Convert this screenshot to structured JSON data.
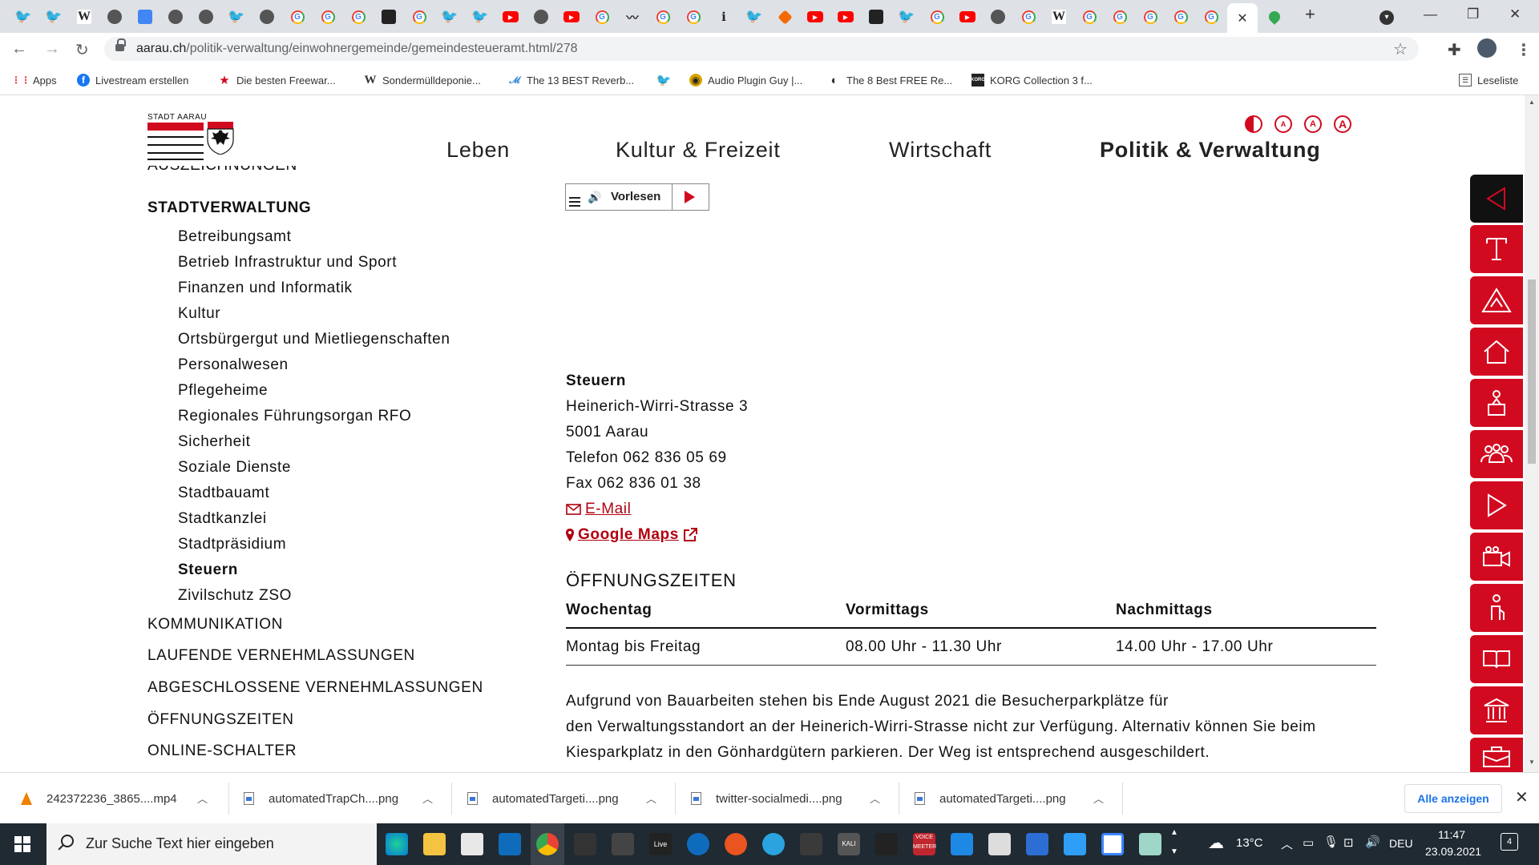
{
  "browser": {
    "url_host": "aarau.ch",
    "url_path": "/politik-verwaltung/einwohnergemeinde/gemeindesteueramt.html/278",
    "active_tab_close": "✕",
    "new_tab": "+"
  },
  "bookmarks": [
    {
      "label": "Apps",
      "icon": "apps-grid-icon"
    },
    {
      "label": "Livestream erstellen",
      "icon": "facebook-icon"
    },
    {
      "label": "Die besten Freewar...",
      "icon": "star-icon"
    },
    {
      "label": "Sondermülldeponie...",
      "icon": "wikipedia-icon"
    },
    {
      "label": "The 13 BEST Reverb...",
      "icon": "bird-icon"
    },
    {
      "label": "",
      "icon": "twitter-icon"
    },
    {
      "label": "Audio Plugin Guy |...",
      "icon": "plugin-icon"
    },
    {
      "label": "The 8 Best FREE Re...",
      "icon": "moon-icon"
    },
    {
      "label": "KORG Collection 3 f...",
      "icon": "korg-icon"
    }
  ],
  "reading_list": "Leseliste",
  "site": {
    "logo_text": "STADT AARAU",
    "nav": [
      "Leben",
      "Kultur & Freizeit",
      "Wirtschaft",
      "Politik & Verwaltung"
    ],
    "access_labels": [
      "A",
      "A",
      "A"
    ],
    "sidebar_top_cut": "AUSZEICHNUNGEN",
    "sidebar_section": "STADTVERWALTUNG",
    "sidebar_items": [
      "Betreibungsamt",
      "Betrieb Infrastruktur und Sport",
      "Finanzen und Informatik",
      "Kultur",
      "Ortsbürgergut und Mietliegenschaften",
      "Personalwesen",
      "Pflegeheime",
      "Regionales Führungsorgan RFO",
      "Sicherheit",
      "Soziale Dienste",
      "Stadtbauamt",
      "Stadtkanzlei",
      "Stadtpräsidium",
      "Steuern",
      "Zivilschutz ZSO"
    ],
    "sidebar_more": [
      "KOMMUNIKATION",
      "LAUFENDE VERNEHMLASSUNGEN",
      "ABGESCHLOSSENE VERNEHMLASSUNGEN",
      "ÖFFNUNGSZEITEN",
      "ONLINE-SCHALTER"
    ],
    "vorlesen": "Vorlesen",
    "contact": {
      "name": "Steuern",
      "street": "Heinerich-Wirri-Strasse 3",
      "city": "5001 Aarau",
      "phone": "Telefon 062 836 05 69",
      "fax": "Fax 062 836 01 38",
      "email": "E-Mail",
      "maps": "Google Maps"
    },
    "hours": {
      "title": "ÖFFNUNGSZEITEN",
      "headers": [
        "Wochentag",
        "Vormittags",
        "Nachmittags"
      ],
      "rows": [
        [
          "Montag bis Freitag",
          "08.00 Uhr - 11.30 Uhr",
          "14.00 Uhr - 17.00 Uhr"
        ]
      ]
    },
    "notice": [
      "Aufgrund von Bauarbeiten stehen bis Ende August 2021 die Besucherparkplätze für",
      "den Verwaltungsstandort an der Heinerich-Wirri-Strasse nicht zur Verfügung. Alternativ können Sie beim",
      "Kiesparkplatz in den Gönhardgütern parkieren. Der Weg ist entsprechend ausgeschildert."
    ]
  },
  "downloads": [
    {
      "name": "242372236_3865....mp4"
    },
    {
      "name": "automatedTrapCh....png"
    },
    {
      "name": "automatedTargeti....png"
    },
    {
      "name": "twitter-socialmedi....png"
    },
    {
      "name": "automatedTargeti....png"
    }
  ],
  "downloads_show_all": "Alle anzeigen",
  "taskbar": {
    "search_placeholder": "Zur Suche Text hier eingeben",
    "weather": "13°C",
    "language": "DEU",
    "time": "11:47",
    "date": "23.09.2021",
    "notifications": "4"
  },
  "colors": {
    "brand_red": "#d20a20",
    "link_red": "#b0000f"
  }
}
